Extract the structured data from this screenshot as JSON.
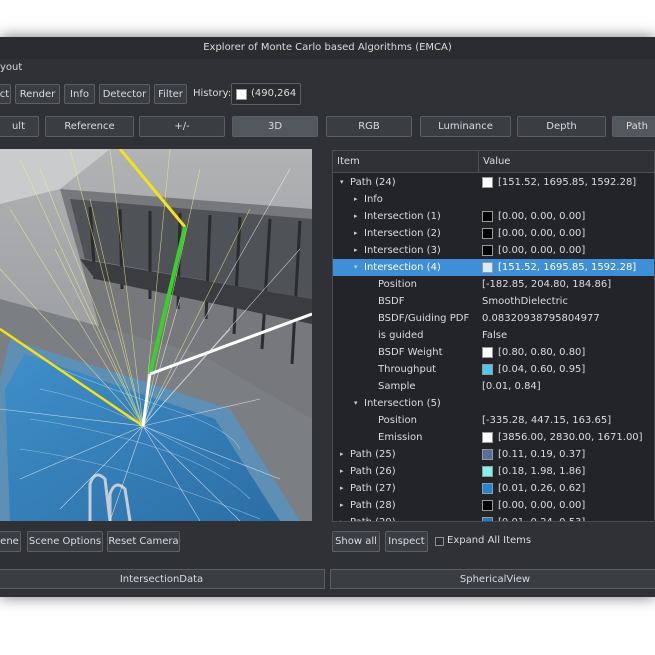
{
  "window": {
    "title": "Explorer of Monte Carlo based Algorithms (EMCA)"
  },
  "menu": {
    "layout_label": "yout"
  },
  "toolbar": {
    "buttons": [
      "ct",
      "Render",
      "Info",
      "Detector",
      "Filter"
    ],
    "history_label": "History:",
    "history_value": "(490,264"
  },
  "view_tabs": [
    "ult",
    "Reference",
    "+/-",
    "3D",
    "RGB",
    "Luminance",
    "Depth",
    "Path"
  ],
  "tree": {
    "header_item": "Item",
    "header_value": "Value",
    "rows": [
      {
        "arrow": "▾",
        "label": "Path (24)",
        "value": "[151.52, 1695.85, 1592.28]",
        "swatch": "#ffffff"
      },
      {
        "arrow": "▸",
        "label": "Info",
        "value": "",
        "swatch": ""
      },
      {
        "arrow": "▸",
        "label": "Intersection (1)",
        "value": "[0.00, 0.00, 0.00]",
        "swatch": "#000000"
      },
      {
        "arrow": "▸",
        "label": "Intersection (2)",
        "value": "[0.00, 0.00, 0.00]",
        "swatch": "#000000"
      },
      {
        "arrow": "▸",
        "label": "Intersection (3)",
        "value": "[0.00, 0.00, 0.00]",
        "swatch": "#000000"
      },
      {
        "arrow": "▾",
        "label": "Intersection (4)",
        "value": "[151.52, 1695.85, 1592.28]",
        "swatch": "#d8ecf6"
      },
      {
        "arrow": "",
        "label": "Position",
        "value": "[-182.85, 204.80, 184.86]",
        "swatch": ""
      },
      {
        "arrow": "",
        "label": "BSDF",
        "value": "SmoothDielectric",
        "swatch": ""
      },
      {
        "arrow": "",
        "label": "BSDF/Guiding PDF",
        "value": "0.08320938795804977",
        "swatch": ""
      },
      {
        "arrow": "",
        "label": "is guided",
        "value": "False",
        "swatch": ""
      },
      {
        "arrow": "",
        "label": "BSDF Weight",
        "value": "[0.80, 0.80, 0.80]",
        "swatch": "#ffffff"
      },
      {
        "arrow": "",
        "label": "Throughput",
        "value": "[0.04, 0.60, 0.95]",
        "swatch": "#4dc8f0"
      },
      {
        "arrow": "",
        "label": "Sample",
        "value": "[0.01, 0.84]",
        "swatch": ""
      },
      {
        "arrow": "▾",
        "label": "Intersection (5)",
        "value": "",
        "swatch": ""
      },
      {
        "arrow": "",
        "label": "Position",
        "value": "[-335.28, 447.15, 163.65]",
        "swatch": ""
      },
      {
        "arrow": "",
        "label": "Emission",
        "value": "[3856.00, 2830.00, 1671.00]",
        "swatch": "#ffffff"
      },
      {
        "arrow": "▸",
        "label": "Path (25)",
        "value": "[0.11, 0.19, 0.37]",
        "swatch": "#5a6e9a"
      },
      {
        "arrow": "▸",
        "label": "Path (26)",
        "value": "[0.18, 1.98, 1.86]",
        "swatch": "#7ff4ee"
      },
      {
        "arrow": "▸",
        "label": "Path (27)",
        "value": "[0.01, 0.26, 0.62]",
        "swatch": "#1f86d4"
      },
      {
        "arrow": "▸",
        "label": "Path (28)",
        "value": "[0.00, 0.00, 0.00]",
        "swatch": "#000000"
      },
      {
        "arrow": "▸",
        "label": "Path (29)",
        "value": "[0.01, 0.24, 0.53]",
        "swatch": "#1f7ac6"
      }
    ]
  },
  "left_actions": [
    "ene",
    "Scene Options",
    "Reset Camera"
  ],
  "right_actions": {
    "show_all": "Show all",
    "inspect": "Inspect",
    "expand_all": "Expand All Items"
  },
  "bottom_tabs": [
    "IntersectionData",
    "SphericalView"
  ],
  "colors": {
    "window_bg": "#2f3136",
    "selection": "#3e8ed8",
    "path_yellow": "#f2e21a",
    "path_green": "#38d12a",
    "path_white": "#ffffff",
    "water": "#3b88c2"
  }
}
